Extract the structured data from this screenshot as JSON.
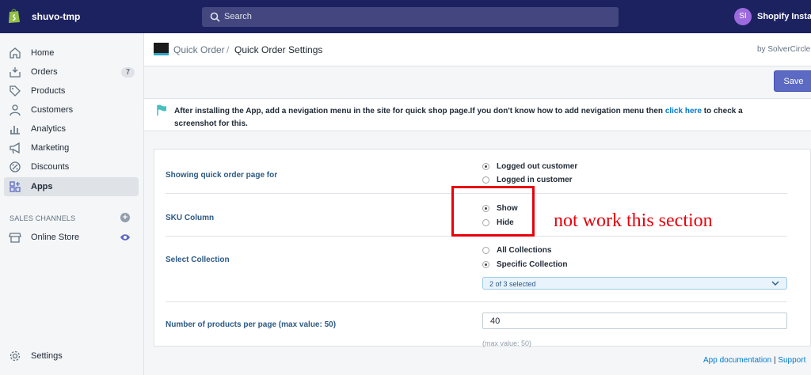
{
  "topbar": {
    "shop_name": "shuvo-tmp",
    "search_placeholder": "Search",
    "avatar_initials": "SI",
    "user_name": "Shopify Install"
  },
  "sidebar": {
    "items": [
      {
        "label": "Home",
        "icon": "home-icon"
      },
      {
        "label": "Orders",
        "icon": "orders-icon",
        "badge": "7"
      },
      {
        "label": "Products",
        "icon": "tag-icon"
      },
      {
        "label": "Customers",
        "icon": "customers-icon"
      },
      {
        "label": "Analytics",
        "icon": "analytics-icon"
      },
      {
        "label": "Marketing",
        "icon": "megaphone-icon"
      },
      {
        "label": "Discounts",
        "icon": "discount-icon"
      },
      {
        "label": "Apps",
        "icon": "apps-icon",
        "active": true
      }
    ],
    "sales_channels_title": "SALES CHANNELS",
    "online_store_label": "Online Store",
    "settings_label": "Settings"
  },
  "header": {
    "breadcrumb_parent": "Quick Order",
    "breadcrumb_sep": "/",
    "breadcrumb_current": "Quick Order Settings",
    "by_text": "by SolverCircle",
    "save_label": "Save"
  },
  "notice": {
    "text_before": "After installing the App, add a nevigation menu in the site for quick shop page.If you don't know how to add nevigation menu then ",
    "link_text": "click here",
    "text_after": " to check a screenshot for this."
  },
  "settings": {
    "showing_label": "Showing quick order page for",
    "showing_options": [
      {
        "label": "Logged out customer",
        "checked": true
      },
      {
        "label": "Logged in customer",
        "checked": false
      }
    ],
    "sku_label": "SKU Column",
    "sku_options": [
      {
        "label": "Show",
        "checked": true
      },
      {
        "label": "Hide",
        "checked": false
      }
    ],
    "collection_label": "Select Collection",
    "collection_options": [
      {
        "label": "All Collections",
        "checked": false
      },
      {
        "label": "Specific Collection",
        "checked": true
      }
    ],
    "collection_selected": "2 of 3 selected",
    "per_page_label": "Number of products per page (max value: 50)",
    "per_page_value": "40",
    "per_page_help": "(max value: 50)"
  },
  "annotation": {
    "text": "not work this section",
    "color": "#e8000b"
  },
  "footer": {
    "doc_link": "App documentation",
    "sep": " | ",
    "support_link": "Support"
  },
  "colors": {
    "topbar_bg": "#1c2260",
    "save_button": "#5c6ac4",
    "link": "#007ace",
    "label": "#2c5a85"
  }
}
